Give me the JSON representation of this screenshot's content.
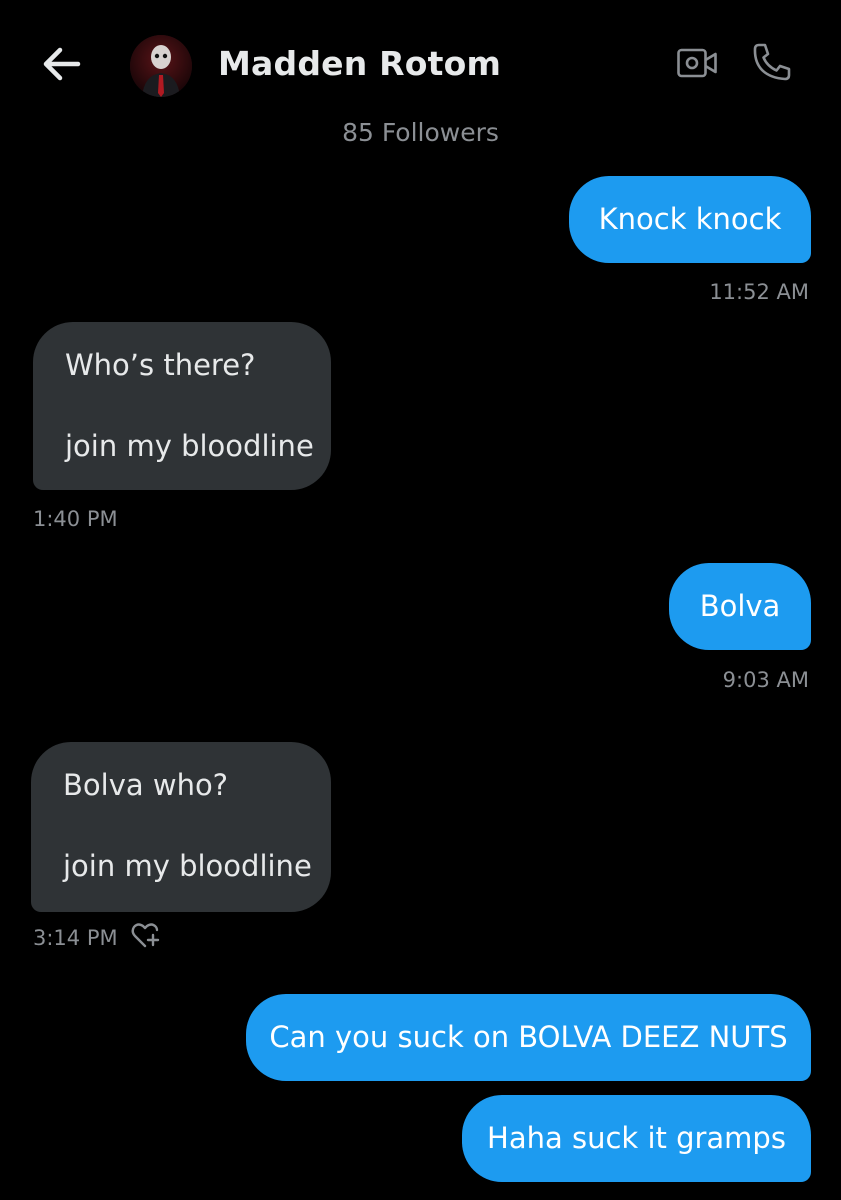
{
  "header": {
    "back_icon": "arrow-left-icon",
    "contact_name": "Madden Rotom",
    "video_icon": "video-camera-icon",
    "call_icon": "phone-icon",
    "followers_text": "85 Followers"
  },
  "colors": {
    "background": "#000000",
    "sent_bubble": "#1d9bf0",
    "received_bubble": "#2f3336",
    "secondary_text": "#8b8f94"
  },
  "messages": [
    {
      "direction": "sent",
      "text": "Knock knock",
      "time": "11:52 AM"
    },
    {
      "direction": "received",
      "line1": "Who’s there?",
      "line2": "join my bloodline",
      "time": "1:40 PM"
    },
    {
      "direction": "sent",
      "text": "Bolva",
      "time": "9:03 AM"
    },
    {
      "direction": "received",
      "line1": "Bolva who?",
      "line2": "join my bloodline",
      "time": "3:14 PM",
      "reaction_icon": "heart-plus-icon"
    },
    {
      "direction": "sent",
      "text": "Can you suck on BOLVA DEEZ NUTS"
    },
    {
      "direction": "sent",
      "text": "Haha suck it gramps"
    }
  ]
}
